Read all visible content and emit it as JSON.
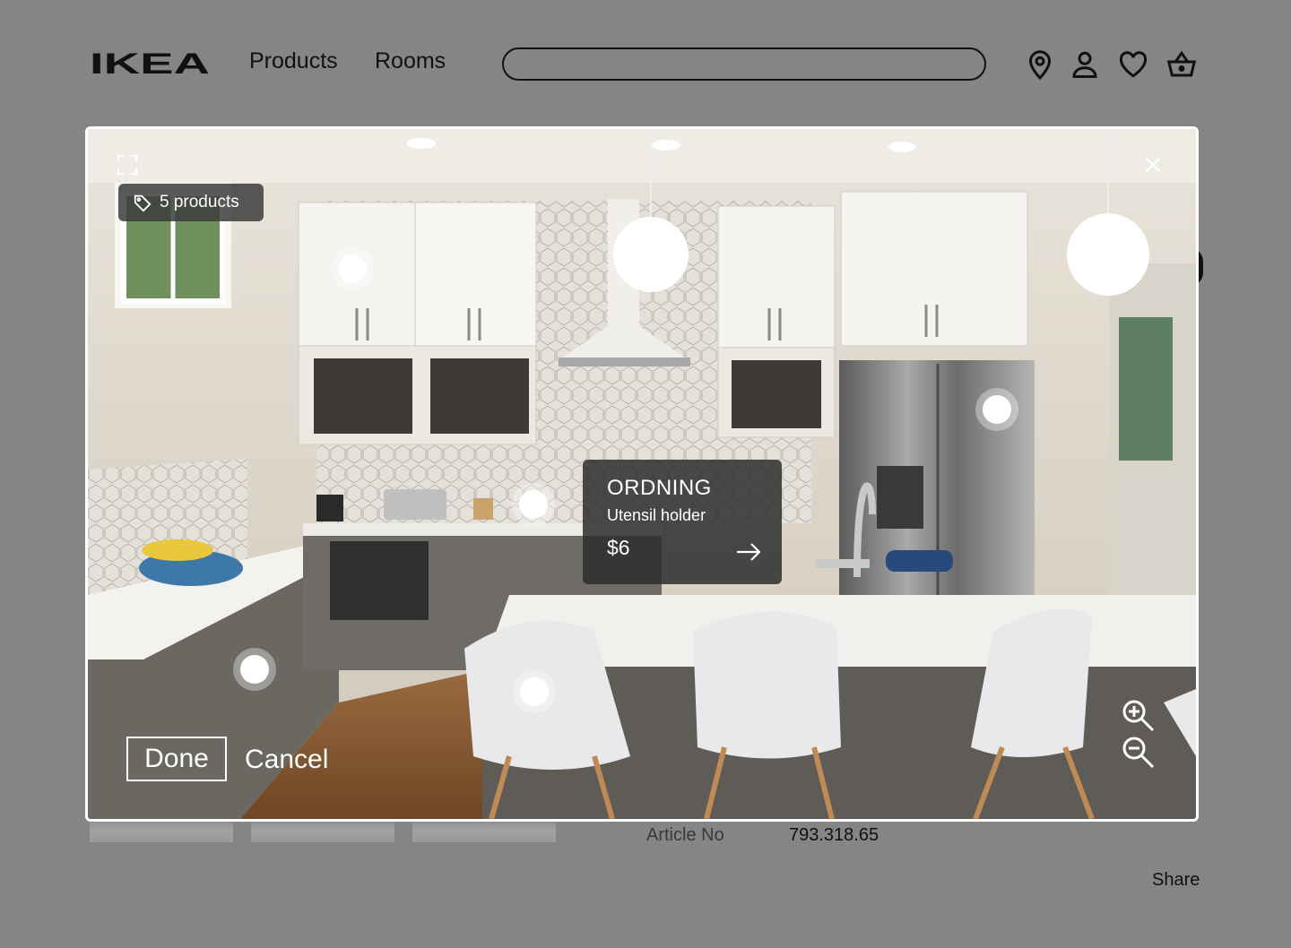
{
  "header": {
    "logo_text": "IKEA",
    "nav": [
      {
        "label": "Products"
      },
      {
        "label": "Rooms"
      }
    ],
    "search": {
      "value": "",
      "placeholder": ""
    },
    "icons": [
      "location-pin-icon",
      "user-icon",
      "heart-icon",
      "basket-icon"
    ]
  },
  "page_behind": {
    "article_label": "Article No",
    "article_value": "793.318.65",
    "share_label": "Share"
  },
  "modal": {
    "badge_label": "5 products",
    "badge_icon": "tag-icon",
    "hotspot_count": 7,
    "tooltip": {
      "name": "ORDNING",
      "description": "Utensil holder",
      "price": "$6"
    },
    "done_label": "Done",
    "cancel_label": "Cancel",
    "icons": [
      "expand-icon",
      "close-icon",
      "zoom-in-icon",
      "zoom-out-icon",
      "arrow-right-icon"
    ]
  }
}
